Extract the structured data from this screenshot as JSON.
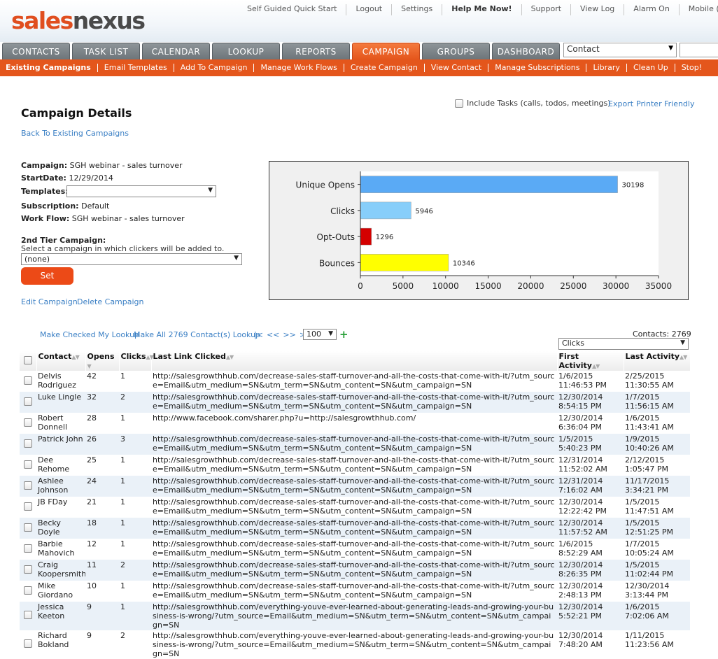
{
  "logo": {
    "part1": "sales",
    "part2": "nexus"
  },
  "top_links": [
    "Self Guided Quick Start",
    "Logout",
    "Settings",
    "Help Me Now!",
    "Support",
    "View Log",
    "Alarm On",
    "Mobile (beta)"
  ],
  "tabs": [
    "CONTACTS",
    "TASK LIST",
    "CALENDAR",
    "LOOKUP",
    "REPORTS",
    "CAMPAIGN",
    "GROUPS",
    "DASHBOARD"
  ],
  "active_tab": "CAMPAIGN",
  "contact_select": "Contact",
  "subnav": [
    "Existing Campaigns",
    "Email Templates",
    "Add To Campaign",
    "Manage Work Flows",
    "Create Campaign",
    "View Contact",
    "Manage Subscriptions",
    "Library",
    "Clean Up",
    "Stop!"
  ],
  "page": {
    "title": "Campaign Details",
    "back_link": "Back To Existing Campaigns",
    "include_tasks": "Include Tasks (calls, todos, meetings)",
    "export": "Export",
    "printer_friendly": "Printer Friendly"
  },
  "details": {
    "campaign_label": "Campaign:",
    "campaign_value": "SGH webinar - sales turnover",
    "startdate_label": "StartDate:",
    "startdate_value": "12/29/2014",
    "templates_label": "Templates:",
    "subscription_label": "Subscription:",
    "subscription_value": "Default",
    "workflow_label": "Work Flow:",
    "workflow_value": "SGH webinar - sales turnover",
    "tier_title": "2nd Tier Campaign:",
    "tier_desc": "Select a campaign in which clickers will be added to.",
    "tier_value": "(none)",
    "set_button": "Set",
    "edit_campaign": "Edit Campaign",
    "delete_campaign": "Delete Campaign"
  },
  "chart_data": {
    "type": "bar",
    "orientation": "horizontal",
    "categories": [
      "Unique Opens",
      "Clicks",
      "Opt-Outs",
      "Bounces"
    ],
    "values": [
      30198,
      5946,
      1296,
      10346
    ],
    "colors": [
      "#5aaaf5",
      "#87cefa",
      "#d40000",
      "#ffff00"
    ],
    "xlim": [
      0,
      35000
    ],
    "xticks": [
      0,
      5000,
      10000,
      15000,
      20000,
      25000,
      30000,
      35000
    ],
    "grid": false
  },
  "table_controls": {
    "make_checked": "Make Checked My Lookup",
    "make_all": "Make All 2769 Contact(s) Lookup",
    "pager": [
      "|<",
      "<<",
      ">>",
      ">|"
    ],
    "page_size": "100",
    "contacts_count": "Contacts: 2769",
    "column_select": "Clicks"
  },
  "columns": [
    "Contact",
    "Opens",
    "Clicks",
    "Last Link Clicked",
    "First Activity",
    "Last Activity"
  ],
  "rows": [
    {
      "contact": "Delvis Rodriguez",
      "opens": "42",
      "clicks": "1",
      "link": "http://salesgrowthhub.com/decrease-sales-staff-turnover-and-all-the-costs-that-come-with-it/?utm_source=Email&utm_medium=SN&utm_term=SN&utm_content=SN&utm_campaign=SN",
      "first": "1/6/2015 11:46:53 PM",
      "last": "2/25/2015 11:30:55 AM"
    },
    {
      "contact": "Luke Lingle",
      "opens": "32",
      "clicks": "2",
      "link": "http://salesgrowthhub.com/decrease-sales-staff-turnover-and-all-the-costs-that-come-with-it/?utm_source=Email&utm_medium=SN&utm_term=SN&utm_content=SN&utm_campaign=SN",
      "first": "12/30/2014 8:54:15 PM",
      "last": "1/7/2015 11:56:15 AM"
    },
    {
      "contact": "Robert Donnell",
      "opens": "28",
      "clicks": "1",
      "link": "http://www.facebook.com/sharer.php?u=http://salesgrowthhub.com/",
      "first": "12/30/2014 6:36:04 PM",
      "last": "1/6/2015 11:43:41 AM"
    },
    {
      "contact": "Patrick John",
      "opens": "26",
      "clicks": "3",
      "link": "http://salesgrowthhub.com/decrease-sales-staff-turnover-and-all-the-costs-that-come-with-it/?utm_source=Email&utm_medium=SN&utm_term=SN&utm_content=SN&utm_campaign=SN",
      "first": "1/5/2015 5:40:23 PM",
      "last": "1/9/2015 10:40:26 AM"
    },
    {
      "contact": "Dee Rehome",
      "opens": "25",
      "clicks": "1",
      "link": "http://salesgrowthhub.com/decrease-sales-staff-turnover-and-all-the-costs-that-come-with-it/?utm_source=Email&utm_medium=SN&utm_term=SN&utm_content=SN&utm_campaign=SN",
      "first": "12/31/2014 11:52:02 AM",
      "last": "2/12/2015 1:05:47 PM"
    },
    {
      "contact": "Ashlee Johnson",
      "opens": "24",
      "clicks": "1",
      "link": "http://salesgrowthhub.com/decrease-sales-staff-turnover-and-all-the-costs-that-come-with-it/?utm_source=Email&utm_medium=SN&utm_term=SN&utm_content=SN&utm_campaign=SN",
      "first": "12/31/2014 7:16:02 AM",
      "last": "11/17/2015 3:34:21 PM"
    },
    {
      "contact": "JB FDay",
      "opens": "21",
      "clicks": "1",
      "link": "http://salesgrowthhub.com/decrease-sales-staff-turnover-and-all-the-costs-that-come-with-it/?utm_source=Email&utm_medium=SN&utm_term=SN&utm_content=SN&utm_campaign=SN",
      "first": "12/30/2014 12:22:42 PM",
      "last": "1/5/2015 11:47:51 AM"
    },
    {
      "contact": "Becky Doyle",
      "opens": "18",
      "clicks": "1",
      "link": "http://salesgrowthhub.com/decrease-sales-staff-turnover-and-all-the-costs-that-come-with-it/?utm_source=Email&utm_medium=SN&utm_term=SN&utm_content=SN&utm_campaign=SN",
      "first": "12/30/2014 11:57:52 AM",
      "last": "1/5/2015 12:51:25 PM"
    },
    {
      "contact": "Barbie Mahovich",
      "opens": "12",
      "clicks": "1",
      "link": "http://salesgrowthhub.com/decrease-sales-staff-turnover-and-all-the-costs-that-come-with-it/?utm_source=Email&utm_medium=SN&utm_term=SN&utm_content=SN&utm_campaign=SN",
      "first": "1/6/2015 8:52:29 AM",
      "last": "1/7/2015 10:05:24 AM"
    },
    {
      "contact": "Craig Koopersmith",
      "opens": "11",
      "clicks": "2",
      "link": "http://salesgrowthhub.com/decrease-sales-staff-turnover-and-all-the-costs-that-come-with-it/?utm_source=Email&utm_medium=SN&utm_term=SN&utm_content=SN&utm_campaign=SN",
      "first": "12/30/2014 8:26:35 PM",
      "last": "1/5/2015 11:02:44 PM"
    },
    {
      "contact": "Mike Giordano",
      "opens": "10",
      "clicks": "1",
      "link": "http://salesgrowthhub.com/decrease-sales-staff-turnover-and-all-the-costs-that-come-with-it/?utm_source=Email&utm_medium=SN&utm_term=SN&utm_content=SN&utm_campaign=SN",
      "first": "12/30/2014 2:48:13 PM",
      "last": "12/30/2014 3:13:44 PM"
    },
    {
      "contact": "Jessica Keeton",
      "opens": "9",
      "clicks": "1",
      "link": "http://salesgrowthhub.com/everything-youve-ever-learned-about-generating-leads-and-growing-your-business-is-wrong/?utm_source=Email&utm_medium=SN&utm_term=SN&utm_content=SN&utm_campaign=SN",
      "first": "12/30/2014 5:52:21 PM",
      "last": "1/6/2015 7:02:06 AM"
    },
    {
      "contact": "Richard Bokland",
      "opens": "9",
      "clicks": "2",
      "link": "http://salesgrowthhub.com/everything-youve-ever-learned-about-generating-leads-and-growing-your-business-is-wrong/?utm_source=Email&utm_medium=SN&utm_term=SN&utm_content=SN&utm_campaign=SN",
      "first": "12/30/2014 7:48:20 AM",
      "last": "1/11/2015 11:23:56 AM"
    }
  ]
}
